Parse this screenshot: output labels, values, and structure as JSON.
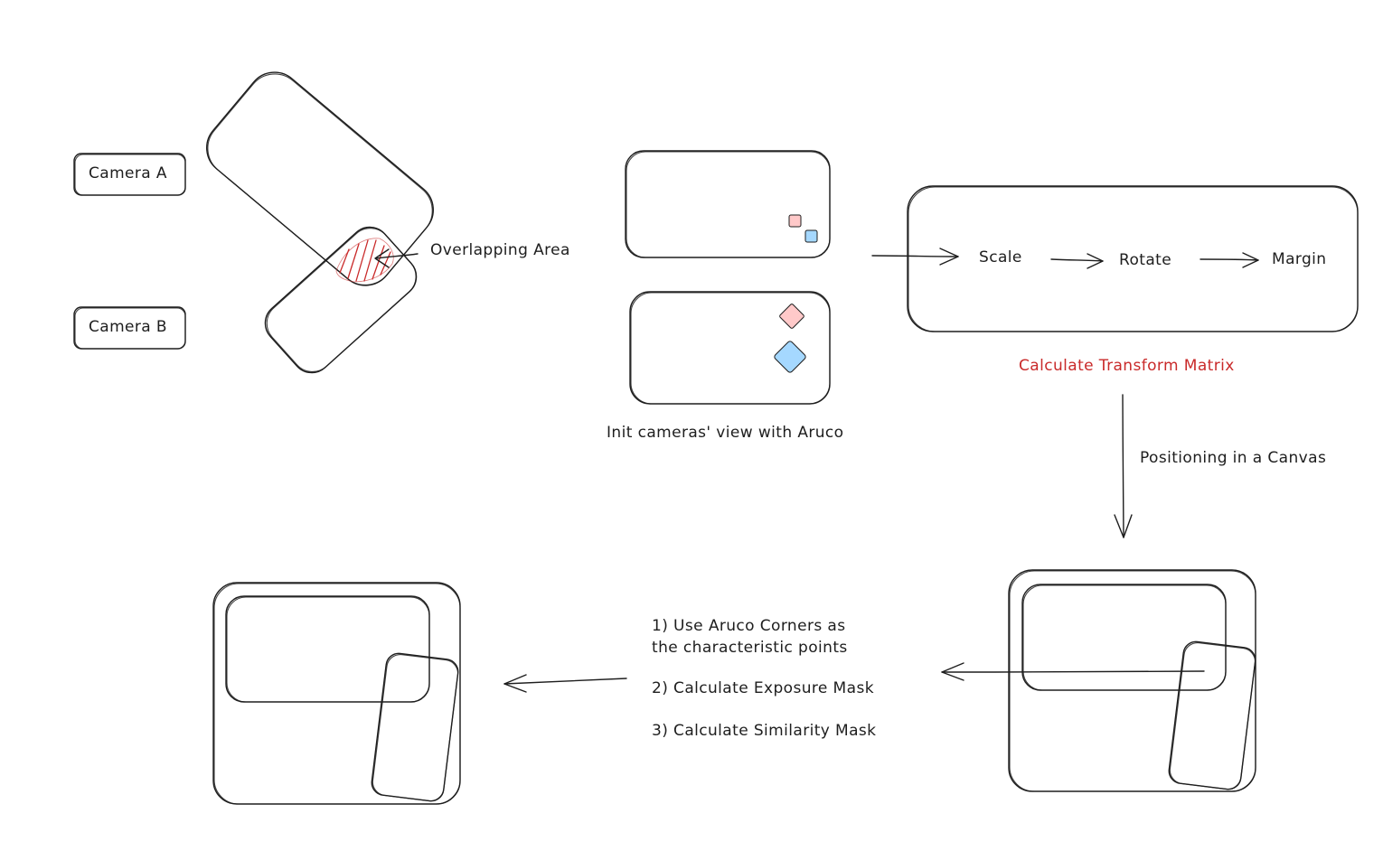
{
  "labels": {
    "camera_a": "Camera A",
    "camera_b": "Camera B",
    "overlap": "Overlapping Area",
    "init": "Init cameras' view with Aruco",
    "scale": "Scale",
    "rotate": "Rotate",
    "margin": "Margin",
    "transform": "Calculate Transform Matrix",
    "positioning": "Positioning in a Canvas",
    "step1": "1) Use Aruco Corners as\nthe characteristic points",
    "step2": "2) Calculate Exposure Mask",
    "step3": "3) Calculate Similarity Mask"
  },
  "colors": {
    "stroke": "#1e1e1e",
    "highlight_red": "#c92a2a",
    "marker_pink_fill": "#ffc9c9",
    "marker_blue_fill": "#a5d8ff"
  }
}
